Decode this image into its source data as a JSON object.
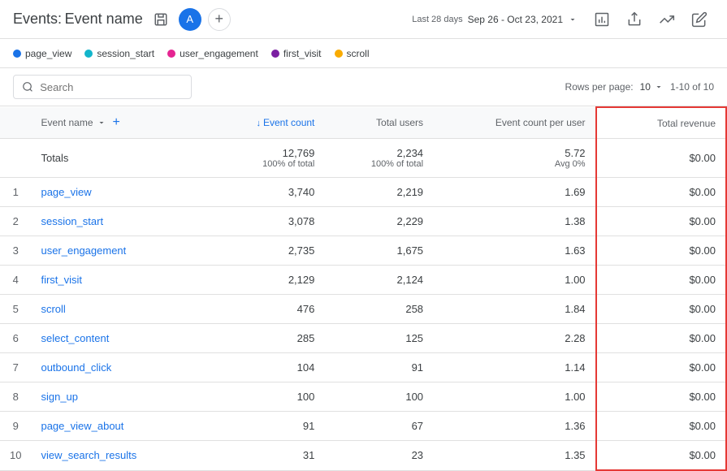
{
  "header": {
    "title_prefix": "Events:",
    "title_name": "Event name",
    "avatar_text": "A",
    "date_period": "Last 28 days",
    "date_range": "Sep 26 - Oct 23, 2021",
    "save_icon": "💾",
    "share_icon": "↗",
    "trend_icon": "~",
    "edit_icon": "✏"
  },
  "legend": {
    "items": [
      {
        "label": "page_view",
        "color": "#1a73e8"
      },
      {
        "label": "session_start",
        "color": "#12b5cb"
      },
      {
        "label": "user_engagement",
        "color": "#e52592"
      },
      {
        "label": "first_visit",
        "color": "#7b1fa2"
      },
      {
        "label": "scroll",
        "color": "#f9ab00"
      }
    ]
  },
  "toolbar": {
    "search_placeholder": "Search",
    "rows_label": "Rows per page:",
    "rows_value": "10",
    "pagination": "1-10 of 10"
  },
  "table": {
    "columns": [
      {
        "key": "num",
        "label": ""
      },
      {
        "key": "event_name",
        "label": "Event name"
      },
      {
        "key": "event_count",
        "label": "↓ Event count",
        "sorted": true
      },
      {
        "key": "total_users",
        "label": "Total users"
      },
      {
        "key": "event_count_per_user",
        "label": "Event count per user"
      },
      {
        "key": "total_revenue",
        "label": "Total revenue",
        "highlighted": true
      }
    ],
    "totals": {
      "event_count": "12,769",
      "event_count_sub": "100% of total",
      "total_users": "2,234",
      "total_users_sub": "100% of total",
      "event_count_per_user": "5.72",
      "event_count_per_user_sub": "Avg 0%",
      "total_revenue": "$0.00"
    },
    "rows": [
      {
        "num": 1,
        "event_name": "page_view",
        "event_count": "3,740",
        "total_users": "2,219",
        "event_count_per_user": "1.69",
        "total_revenue": "$0.00"
      },
      {
        "num": 2,
        "event_name": "session_start",
        "event_count": "3,078",
        "total_users": "2,229",
        "event_count_per_user": "1.38",
        "total_revenue": "$0.00"
      },
      {
        "num": 3,
        "event_name": "user_engagement",
        "event_count": "2,735",
        "total_users": "1,675",
        "event_count_per_user": "1.63",
        "total_revenue": "$0.00"
      },
      {
        "num": 4,
        "event_name": "first_visit",
        "event_count": "2,129",
        "total_users": "2,124",
        "event_count_per_user": "1.00",
        "total_revenue": "$0.00"
      },
      {
        "num": 5,
        "event_name": "scroll",
        "event_count": "476",
        "total_users": "258",
        "event_count_per_user": "1.84",
        "total_revenue": "$0.00"
      },
      {
        "num": 6,
        "event_name": "select_content",
        "event_count": "285",
        "total_users": "125",
        "event_count_per_user": "2.28",
        "total_revenue": "$0.00"
      },
      {
        "num": 7,
        "event_name": "outbound_click",
        "event_count": "104",
        "total_users": "91",
        "event_count_per_user": "1.14",
        "total_revenue": "$0.00"
      },
      {
        "num": 8,
        "event_name": "sign_up",
        "event_count": "100",
        "total_users": "100",
        "event_count_per_user": "1.00",
        "total_revenue": "$0.00"
      },
      {
        "num": 9,
        "event_name": "page_view_about",
        "event_count": "91",
        "total_users": "67",
        "event_count_per_user": "1.36",
        "total_revenue": "$0.00"
      },
      {
        "num": 10,
        "event_name": "view_search_results",
        "event_count": "31",
        "total_users": "23",
        "event_count_per_user": "1.35",
        "total_revenue": "$0.00"
      }
    ]
  }
}
